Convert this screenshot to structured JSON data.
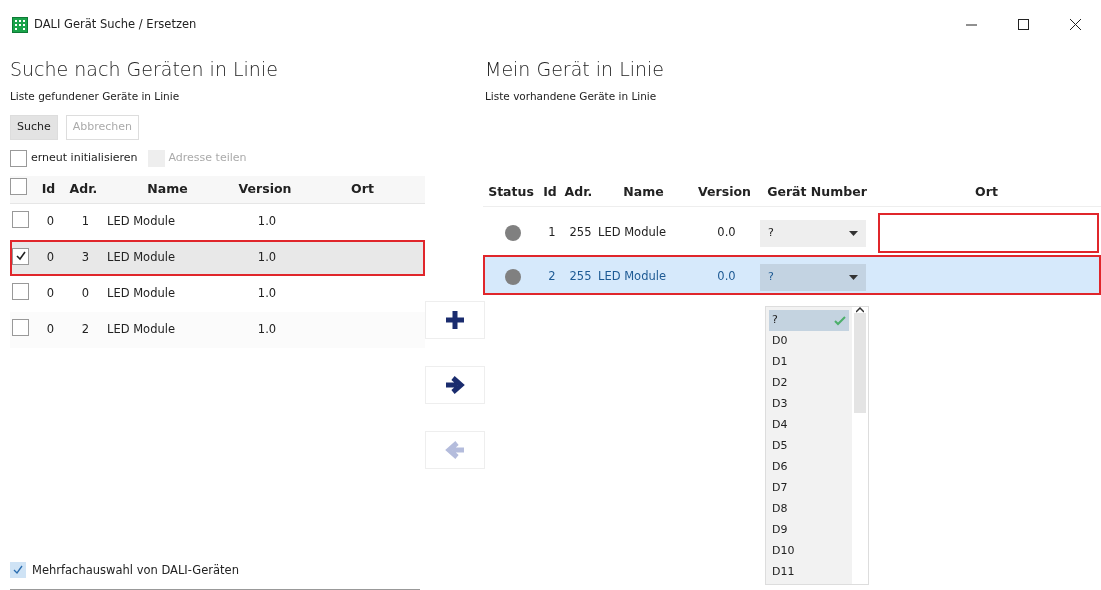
{
  "window": {
    "title": "DALI Gerät Suche / Ersetzen"
  },
  "search_panel": {
    "heading": "Suche nach Geräten in Linie",
    "subtitle": "Liste gefundener Geräte in Linie",
    "buttons": [
      {
        "label": "Suche",
        "disabled": false
      },
      {
        "label": "Abbrechen",
        "disabled": true
      }
    ],
    "options": [
      {
        "label": "erneut initialisieren",
        "checked": false,
        "disabled": false
      },
      {
        "label": "Adresse teilen",
        "checked": false,
        "disabled": true
      }
    ],
    "table": {
      "header_checked": false,
      "columns": [
        "Id",
        "Adr.",
        "Name",
        "Version",
        "Ort"
      ],
      "rows": [
        {
          "checked": false,
          "selected": false,
          "outlined": false,
          "cells": [
            "0",
            "1",
            "LED Module",
            "1.0",
            ""
          ]
        },
        {
          "checked": true,
          "selected": true,
          "outlined": true,
          "cells": [
            "0",
            "3",
            "LED Module",
            "1.0",
            ""
          ]
        },
        {
          "checked": false,
          "selected": false,
          "outlined": false,
          "cells": [
            "0",
            "0",
            "LED Module",
            "1.0",
            ""
          ]
        },
        {
          "checked": false,
          "selected": false,
          "outlined": false,
          "cells": [
            "0",
            "2",
            "LED Module",
            "1.0",
            ""
          ]
        }
      ]
    },
    "multi_select": {
      "label": "Mehrfachauswahl von DALI-Geräten",
      "checked": true
    }
  },
  "transfer_buttons": [
    {
      "kind": "plus",
      "disabled": false
    },
    {
      "kind": "right",
      "disabled": false
    },
    {
      "kind": "left",
      "disabled": true
    }
  ],
  "line_panel": {
    "heading": "Mein Gerät in Linie",
    "subtitle": "Liste vorhandene Geräte in Linie",
    "table": {
      "columns": [
        "Status",
        "Id",
        "Adr.",
        "Name",
        "Version",
        "Gerät Number",
        "Ort"
      ],
      "rows": [
        {
          "color": "#808080",
          "selected": false,
          "outlined": false,
          "ort_outlined": true,
          "id": "1",
          "adr": "255",
          "name": "LED Module",
          "version": "0.0",
          "device_number": "?"
        },
        {
          "color": "#808080",
          "selected": true,
          "outlined": true,
          "ort_outlined": false,
          "id": "2",
          "adr": "255",
          "name": "LED Module",
          "version": "0.0",
          "device_number": "?"
        }
      ]
    },
    "dropdown": {
      "items": [
        {
          "label": "?",
          "selected": true
        },
        {
          "label": "D0",
          "selected": false
        },
        {
          "label": "D1",
          "selected": false
        },
        {
          "label": "D2",
          "selected": false
        },
        {
          "label": "D3",
          "selected": false
        },
        {
          "label": "D4",
          "selected": false
        },
        {
          "label": "D5",
          "selected": false
        },
        {
          "label": "D6",
          "selected": false
        },
        {
          "label": "D7",
          "selected": false
        },
        {
          "label": "D8",
          "selected": false
        },
        {
          "label": "D9",
          "selected": false
        },
        {
          "label": "D10",
          "selected": false
        },
        {
          "label": "D11",
          "selected": false
        }
      ]
    }
  }
}
